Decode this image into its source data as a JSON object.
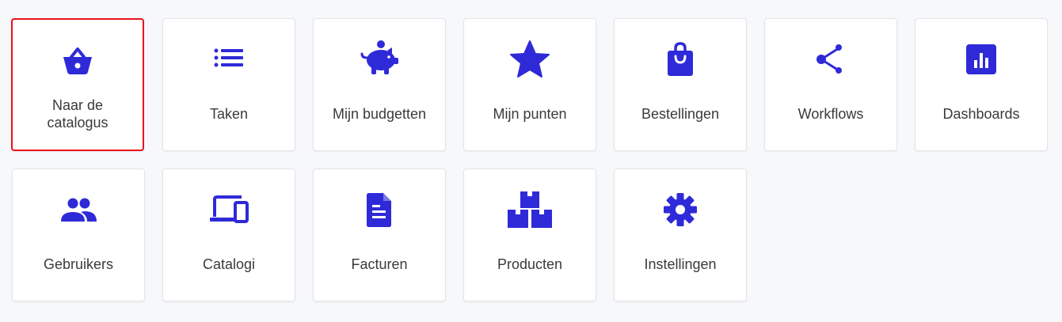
{
  "accent_color": "#2f2ad8",
  "selected_border_color": "#e8131b",
  "tiles": [
    {
      "label": "Naar de catalogus",
      "icon": "basket-icon",
      "selected": true
    },
    {
      "label": "Taken",
      "icon": "list-icon"
    },
    {
      "label": "Mijn budgetten",
      "icon": "piggy-bank-icon"
    },
    {
      "label": "Mijn punten",
      "icon": "star-icon"
    },
    {
      "label": "Bestellingen",
      "icon": "shopping-bag-icon"
    },
    {
      "label": "Workflows",
      "icon": "share-nodes-icon"
    },
    {
      "label": "Dashboards",
      "icon": "bar-chart-icon"
    },
    {
      "label": "Gebruikers",
      "icon": "users-icon"
    },
    {
      "label": "Catalogi",
      "icon": "devices-icon"
    },
    {
      "label": "Facturen",
      "icon": "document-icon"
    },
    {
      "label": "Producten",
      "icon": "boxes-icon"
    },
    {
      "label": "Instellingen",
      "icon": "gear-icon"
    }
  ]
}
